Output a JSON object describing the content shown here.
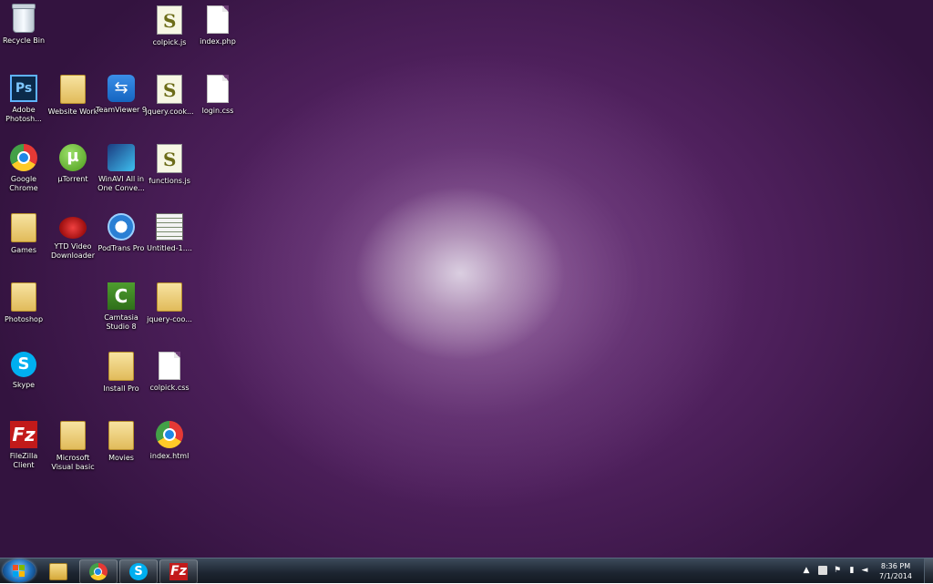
{
  "desktop": {
    "icons": {
      "recycle_bin": "Recycle Bin",
      "colpick_js": "colpick.js",
      "index_php": "index.php",
      "photoshop_app": "Adobe Photosh...",
      "website_work": "Website Work",
      "teamviewer": "TeamViewer 9",
      "jquery_cookie": "jquery.cook...",
      "login_css": "login.css",
      "chrome": "Google Chrome",
      "utorrent": "µTorrent",
      "winavi": "WinAVI All in One Conve...",
      "functions_js": "functions.js",
      "games": "Games",
      "ytd": "YTD Video Downloader",
      "podtrans": "PodTrans Pro",
      "untitled": "Untitled-1....",
      "photoshop_folder": "Photoshop",
      "camtasia": "Camtasia Studio 8",
      "jquery_coo_folder": "jquery-coo...",
      "skype": "Skype",
      "install_pro": "Install Pro",
      "colpick_css": "colpick.css",
      "filezilla": "FileZilla Client",
      "ms_visual_basic": "Microsoft Visual basic",
      "movies": "Movies",
      "index_html": "index.html"
    },
    "glyphs": {
      "photoshop": "Ps",
      "utorrent": "µ",
      "teamviewer": "⇆",
      "script": "S",
      "camtasia": "C",
      "skype": "S",
      "filezilla": "Fz"
    }
  },
  "taskbar": {
    "skype_glyph": "S",
    "filezilla_glyph": "Fz",
    "tray": {
      "chevron": "▲",
      "flag": "⚑",
      "signal": "▮",
      "volume": "◄"
    },
    "clock": {
      "time": "8:36 PM",
      "date": "7/1/2014"
    }
  }
}
